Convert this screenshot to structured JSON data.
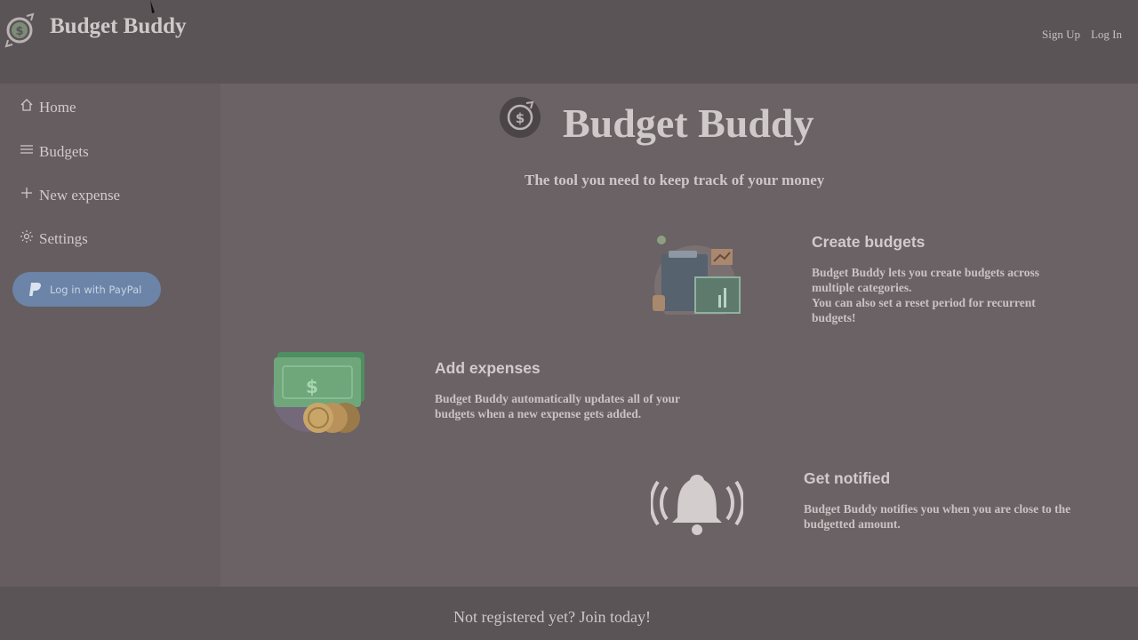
{
  "header": {
    "brand": "Budget Buddy",
    "links": {
      "signup": "Sign Up",
      "login": "Log In"
    }
  },
  "sidebar": {
    "items": [
      {
        "label": "Home",
        "icon": "home-icon"
      },
      {
        "label": "Budgets",
        "icon": "menu-icon"
      },
      {
        "label": "New expense",
        "icon": "plus-icon"
      },
      {
        "label": "Settings",
        "icon": "gear-icon"
      }
    ],
    "paypal_label": "Log in with PayPal"
  },
  "main": {
    "title": "Budget Buddy",
    "tagline": "The tool you need to keep track of your money",
    "features": [
      {
        "title": "Create budgets",
        "lines": [
          "Budget Buddy lets you create budgets across",
          "multiple categories.",
          "You can also set a reset period for recurrent",
          "budgets!"
        ]
      },
      {
        "title": "Add expenses",
        "lines": [
          "Budget Buddy automatically updates all of your",
          "budgets when a new expense gets added."
        ]
      },
      {
        "title": "Get notified",
        "lines": [
          "Budget Buddy notifies you when you are close to the",
          "budgetted amount."
        ]
      }
    ]
  },
  "footer": {
    "cta": "Not registered yet? Join today!"
  },
  "colors": {
    "overlay_bg": "#6a6264",
    "header_bg": "#5b5456",
    "paypal": "#6b84a8"
  }
}
